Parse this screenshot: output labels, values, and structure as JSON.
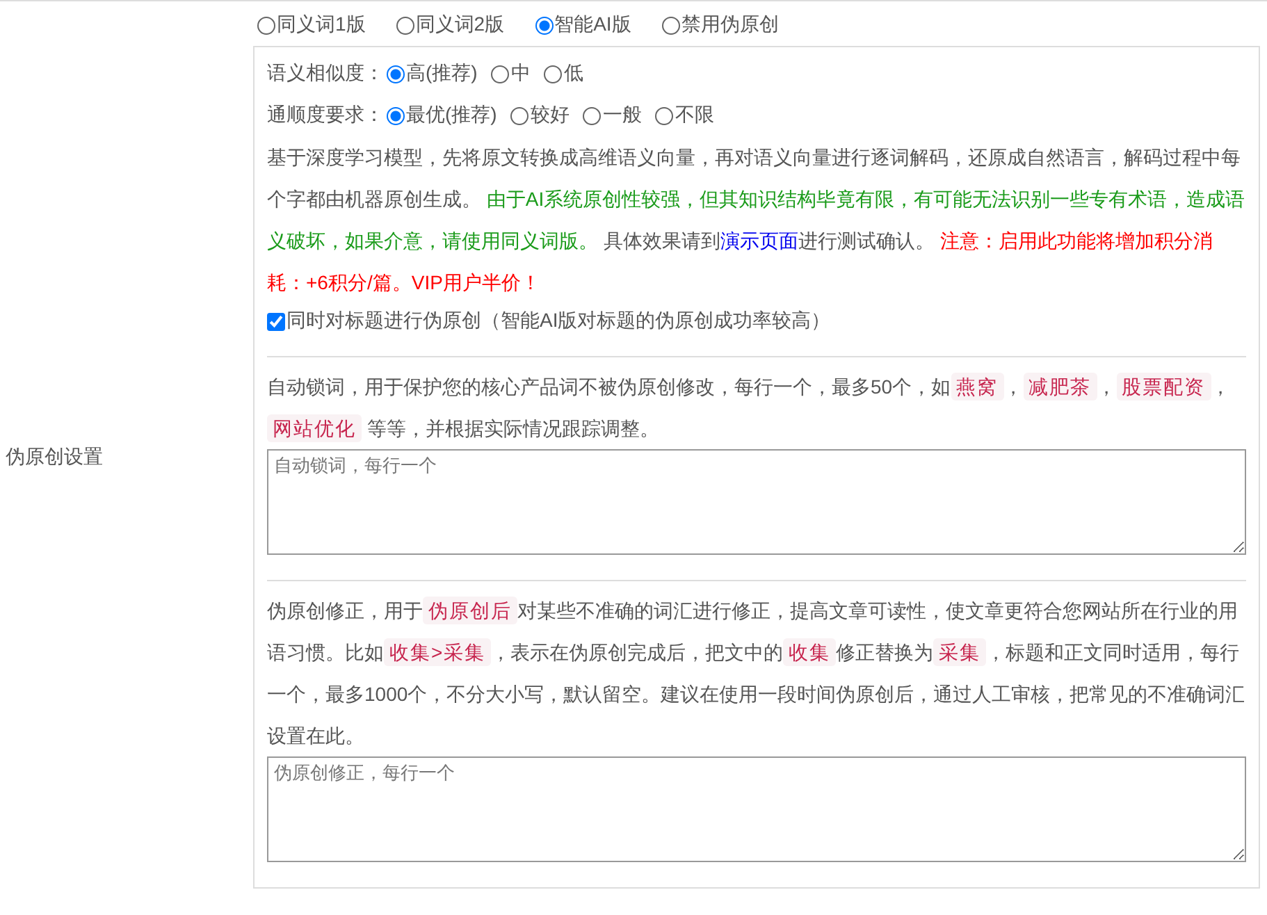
{
  "section_label": "伪原创设置",
  "modes": [
    {
      "label": "同义词1版",
      "selected": false
    },
    {
      "label": "同义词2版",
      "selected": false
    },
    {
      "label": "智能AI版",
      "selected": true
    },
    {
      "label": "禁用伪原创",
      "selected": false
    }
  ],
  "ai_options": [
    {
      "label": "语义相似度：",
      "choices": [
        {
          "label": "高(推荐)",
          "selected": true
        },
        {
          "label": "中",
          "selected": false
        },
        {
          "label": "低",
          "selected": false
        }
      ]
    },
    {
      "label": "通顺度要求：",
      "choices": [
        {
          "label": "最优(推荐)",
          "selected": true
        },
        {
          "label": "较好",
          "selected": false
        },
        {
          "label": "一般",
          "selected": false
        },
        {
          "label": "不限",
          "selected": false
        }
      ]
    }
  ],
  "ai_description": [
    {
      "kind": "text",
      "text": "基于深度学习模型，先将原文转换成高维语义向量，再对语义向量进行逐词解码，还原成自然语言，解码过程中每个字都由机器原创生成。 "
    },
    {
      "kind": "green",
      "text": "由于AI系统原创性较强，但其知识结构毕竟有限，有可能无法识别一些专有术语，造成语义破坏，如果介意，请使用同义词版。"
    },
    {
      "kind": "text",
      "text": " 具体效果请到"
    },
    {
      "kind": "link",
      "text": "演示页面"
    },
    {
      "kind": "text",
      "text": "进行测试确认。 "
    },
    {
      "kind": "red",
      "text": "注意：启用此功能将增加积分消耗：+6积分/篇。VIP用户半价！"
    }
  ],
  "title_option": {
    "label": "同时对标题进行伪原创（智能AI版对标题的伪原创成功率较高）",
    "checked": true
  },
  "lock_words": {
    "description": [
      {
        "kind": "text",
        "text": "自动锁词，用于保护您的核心产品词不被伪原创修改，每行一个，最多50个，如"
      },
      {
        "kind": "tag",
        "text": "燕窝"
      },
      {
        "kind": "text",
        "text": "，"
      },
      {
        "kind": "tag",
        "text": "减肥茶"
      },
      {
        "kind": "text",
        "text": "，"
      },
      {
        "kind": "tag",
        "text": "股票配资"
      },
      {
        "kind": "text",
        "text": "，"
      },
      {
        "kind": "tag",
        "text": "网站优化"
      },
      {
        "kind": "text",
        "text": " 等等，并根据实际情况跟踪调整。"
      }
    ],
    "placeholder": "自动锁词，每行一个"
  },
  "corrections": {
    "description": [
      {
        "kind": "text",
        "text": "伪原创修正，用于"
      },
      {
        "kind": "tag",
        "text": "伪原创后"
      },
      {
        "kind": "text",
        "text": "对某些不准确的词汇进行修正，提高文章可读性，使文章更符合您网站所在行业的用语习惯。比如"
      },
      {
        "kind": "tag",
        "text": "收集>采集"
      },
      {
        "kind": "text",
        "text": "，表示在伪原创完成后，把文中的"
      },
      {
        "kind": "tag",
        "text": "收集"
      },
      {
        "kind": "text",
        "text": "修正替换为"
      },
      {
        "kind": "tag",
        "text": "采集"
      },
      {
        "kind": "text",
        "text": "，标题和正文同时适用，每行一个，最多1000个，不分大小写，默认留空。建议在使用一段时间伪原创后，通过人工审核，把常见的不准确词汇设置在此。"
      }
    ],
    "placeholder": "伪原创修正，每行一个"
  }
}
